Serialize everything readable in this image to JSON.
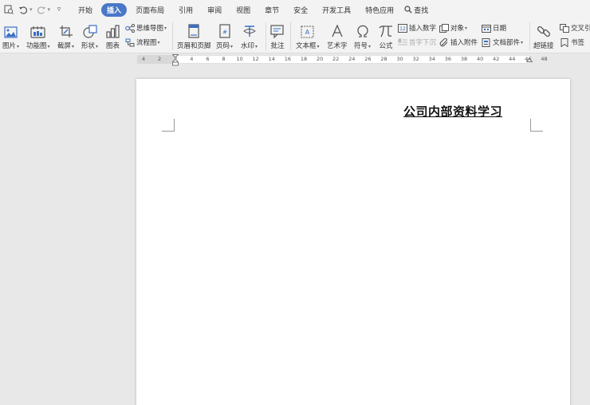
{
  "quick_access": {
    "icons": [
      "preview-icon",
      "undo-icon",
      "redo-icon",
      "customize-icon"
    ]
  },
  "menu": {
    "tabs": [
      {
        "label": "开始",
        "active": false
      },
      {
        "label": "插入",
        "active": true
      },
      {
        "label": "页面布局",
        "active": false
      },
      {
        "label": "引用",
        "active": false
      },
      {
        "label": "审阅",
        "active": false
      },
      {
        "label": "视图",
        "active": false
      },
      {
        "label": "章节",
        "active": false
      },
      {
        "label": "安全",
        "active": false
      },
      {
        "label": "开发工具",
        "active": false
      },
      {
        "label": "特色应用",
        "active": false
      }
    ],
    "search_label": "查找"
  },
  "ribbon": {
    "picture": "图片",
    "function_chart": "功能图",
    "screenshot": "截屏",
    "shape": "形状",
    "chart": "图表",
    "mind_map": "思维导图",
    "flowchart": "流程图",
    "header_footer": "页眉和页脚",
    "page_number": "页码",
    "watermark": "水印",
    "comment": "批注",
    "textbox": "文本框",
    "wordart": "艺术字",
    "symbol": "符号",
    "formula": "公式",
    "insert_number": "插入数字",
    "drop_cap": "首字下沉",
    "object": "对象",
    "attachment": "插入附件",
    "date": "日期",
    "doc_parts": "文档部件",
    "hyperlink": "超链接",
    "cross_ref": "交叉引",
    "bookmark": "书签"
  },
  "ruler": {
    "numbers": [
      "4",
      "2",
      "2",
      "4",
      "6",
      "8",
      "10",
      "12",
      "14",
      "16",
      "18",
      "20",
      "22",
      "24",
      "26",
      "28",
      "30",
      "32",
      "34",
      "36",
      "38",
      "40",
      "42",
      "44",
      "46",
      "48"
    ]
  },
  "document": {
    "title": "公司内部资料学习"
  },
  "colors": {
    "accent": "#4a78c8",
    "background": "#e8e8e8",
    "toolbar": "#f3f3f3"
  }
}
